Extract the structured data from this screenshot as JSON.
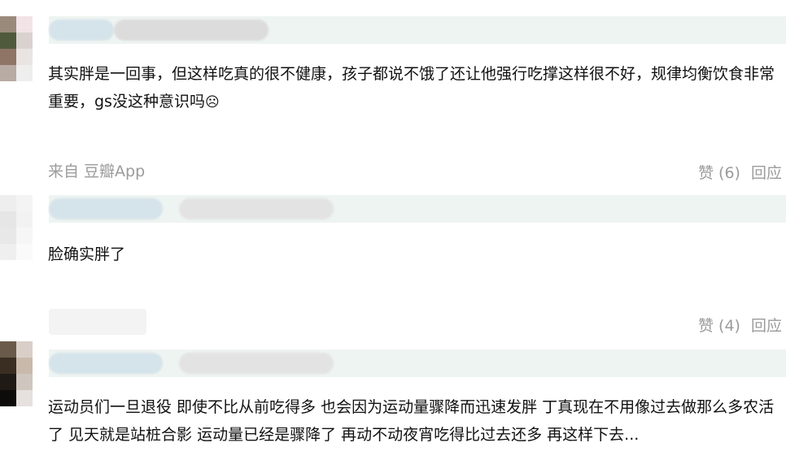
{
  "comments": [
    {
      "text": "其实胖是一回事，但这样吃真的很不健康，孩子都说不饿了还让他强行吃撑这样很不好，规律均衡饮食非常重要，gs没这种意识吗",
      "emoji": "☹",
      "source": "来自 豆瓣App",
      "like_label": "赞 (6)",
      "reply_label": "回应"
    },
    {
      "text": "脸确实胖了",
      "like_label": "赞 (4)",
      "reply_label": "回应"
    },
    {
      "text": "运动员们一旦退役 即使不比从前吃得多 也会因为运动量骤降而迅速发胖 丁真现在不用像过去做那么多农活了 见天就是站桩合影 运动量已经是骤降了 再动不动夜宵吃得比过去还多 再这样下去..."
    }
  ],
  "colors": {
    "text": "#111111",
    "meta": "#9b9b9b",
    "name_bar": "#eef4f1"
  }
}
